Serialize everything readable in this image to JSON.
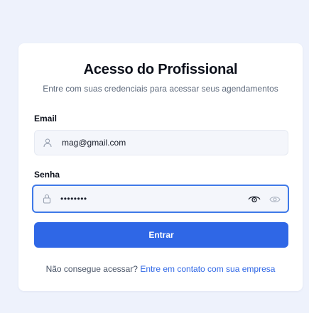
{
  "login": {
    "title": "Acesso do Profissional",
    "subtitle": "Entre com suas credenciais para acessar seus agendamentos",
    "email_label": "Email",
    "email_value": "mag@gmail.com",
    "password_label": "Senha",
    "password_value": "••••••••",
    "submit_label": "Entrar",
    "footer_text": "Não consegue acessar?",
    "footer_link": "Entre em contato com sua empresa"
  },
  "icons": {
    "email_field": "user-icon",
    "password_field": "lock-icon",
    "toggle_visibility": "eye-icon",
    "secondary_eye": "eye-icon"
  },
  "colors": {
    "background": "#eef2fc",
    "card": "#ffffff",
    "primary": "#2f67e6",
    "focus_border": "#3f79e8",
    "field_bg": "#f4f6fb"
  }
}
